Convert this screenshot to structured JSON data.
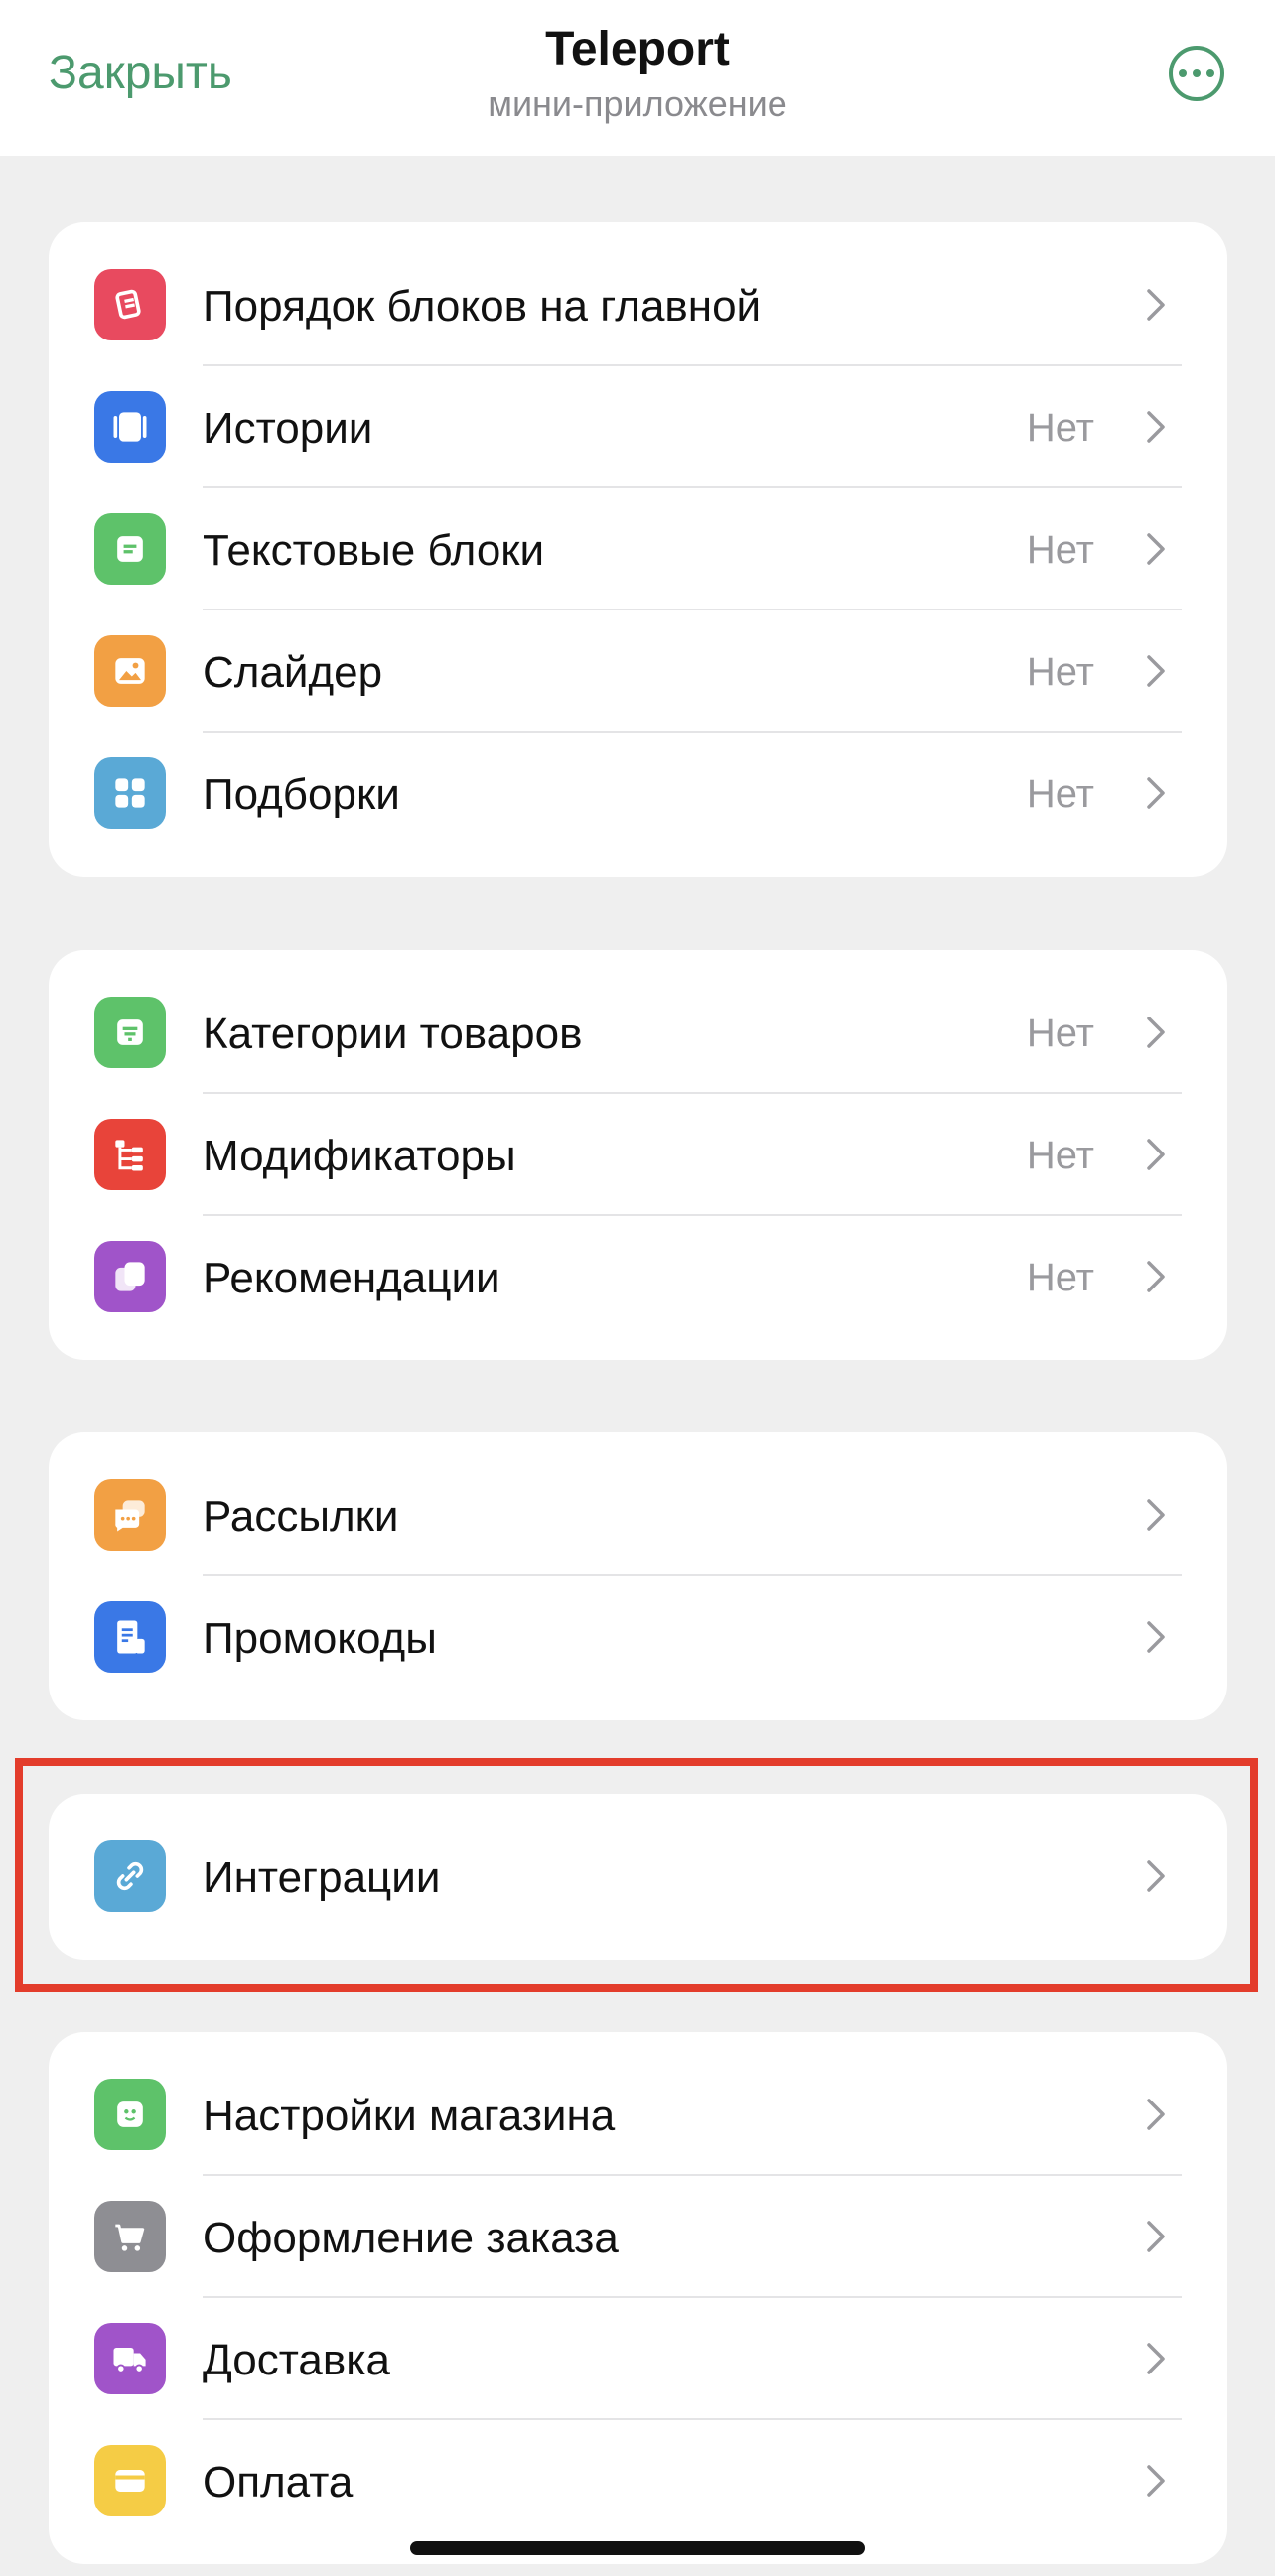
{
  "header": {
    "close_label": "Закрыть",
    "title": "Teleport",
    "subtitle": "мини-приложение",
    "more_icon": "more-horizontal-icon"
  },
  "groups": [
    {
      "items": [
        {
          "label": "Порядок блоков на главной",
          "value": "",
          "icon": "blocks-order-icon",
          "color": "#e84a5f"
        },
        {
          "label": "Истории",
          "value": "Нет",
          "icon": "stories-icon",
          "color": "#3a78e6"
        },
        {
          "label": "Текстовые блоки",
          "value": "Нет",
          "icon": "text-block-icon",
          "color": "#5ec26a"
        },
        {
          "label": "Слайдер",
          "value": "Нет",
          "icon": "image-slider-icon",
          "color": "#f2a044"
        },
        {
          "label": "Подборки",
          "value": "Нет",
          "icon": "collections-grid-icon",
          "color": "#5aa9d6"
        }
      ]
    },
    {
      "items": [
        {
          "label": "Категории товаров",
          "value": "Нет",
          "icon": "categories-icon",
          "color": "#5ec26a"
        },
        {
          "label": "Модификаторы",
          "value": "Нет",
          "icon": "modifiers-tree-icon",
          "color": "#e8443a"
        },
        {
          "label": "Рекомендации",
          "value": "Нет",
          "icon": "recommendations-icon",
          "color": "#a054c9"
        }
      ]
    },
    {
      "items": [
        {
          "label": "Рассылки",
          "value": "",
          "icon": "mailing-chat-icon",
          "color": "#f2a044"
        },
        {
          "label": "Промокоды",
          "value": "",
          "icon": "promocode-receipt-icon",
          "color": "#3a78e6"
        }
      ]
    },
    {
      "items": [
        {
          "label": "Интеграции",
          "value": "",
          "icon": "link-icon",
          "color": "#5aa9d6"
        }
      ]
    },
    {
      "items": [
        {
          "label": "Настройки магазина",
          "value": "",
          "icon": "store-settings-icon",
          "color": "#5ec26a"
        },
        {
          "label": "Оформление заказа",
          "value": "",
          "icon": "cart-icon",
          "color": "#8e8e93"
        },
        {
          "label": "Доставка",
          "value": "",
          "icon": "delivery-truck-icon",
          "color": "#a054c9"
        },
        {
          "label": "Оплата",
          "value": "",
          "icon": "payment-card-icon",
          "color": "#f5cc45"
        }
      ]
    }
  ],
  "highlight_color": "#e33c2b"
}
